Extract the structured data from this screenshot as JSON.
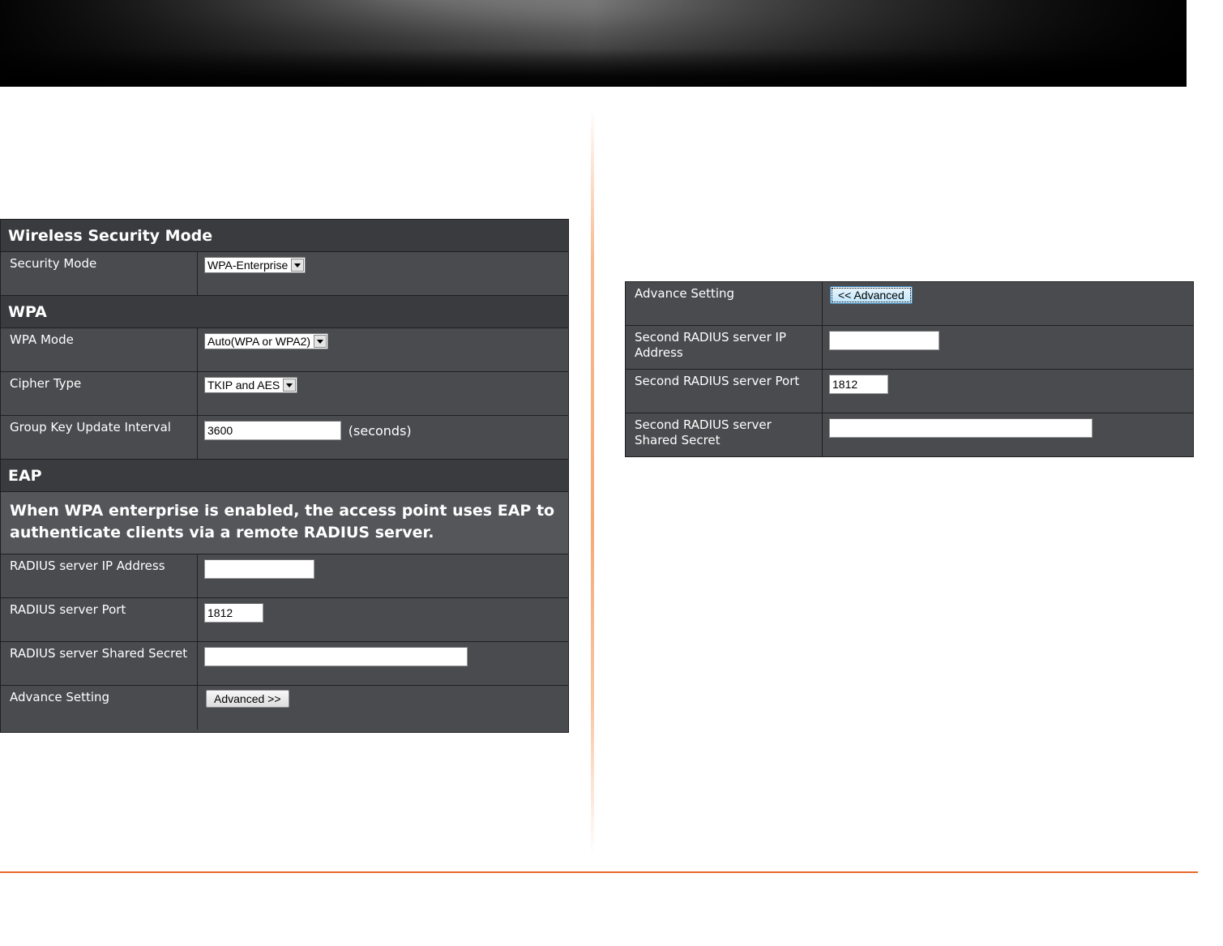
{
  "left": {
    "sections": {
      "wireless": {
        "title": "Wireless Security Mode",
        "security_mode_label": "Security Mode",
        "security_mode_value": "WPA-Enterprise"
      },
      "wpa": {
        "title": "WPA",
        "wpa_mode_label": "WPA Mode",
        "wpa_mode_value": "Auto(WPA or WPA2)",
        "cipher_label": "Cipher Type",
        "cipher_value": "TKIP and AES",
        "group_key_label": "Group Key Update Interval",
        "group_key_value": "3600",
        "group_key_unit": "(seconds)"
      },
      "eap": {
        "title": "EAP",
        "note": "When WPA enterprise is enabled, the access point uses EAP to authenticate clients via a remote RADIUS server.",
        "radius_ip_label": "RADIUS server IP Address",
        "radius_ip_value": "",
        "radius_port_label": "RADIUS server Port",
        "radius_port_value": "1812",
        "radius_secret_label": "RADIUS server Shared Secret",
        "radius_secret_value": "",
        "advance_label": "Advance Setting",
        "advance_button": "Advanced >>"
      }
    }
  },
  "right": {
    "advance_label": "Advance Setting",
    "advance_button": "<< Advanced",
    "second_ip_label": "Second RADIUS server IP Address",
    "second_ip_value": "",
    "second_port_label": "Second RADIUS server Port",
    "second_port_value": "1812",
    "second_secret_label": "Second RADIUS server Shared Secret",
    "second_secret_value": ""
  }
}
